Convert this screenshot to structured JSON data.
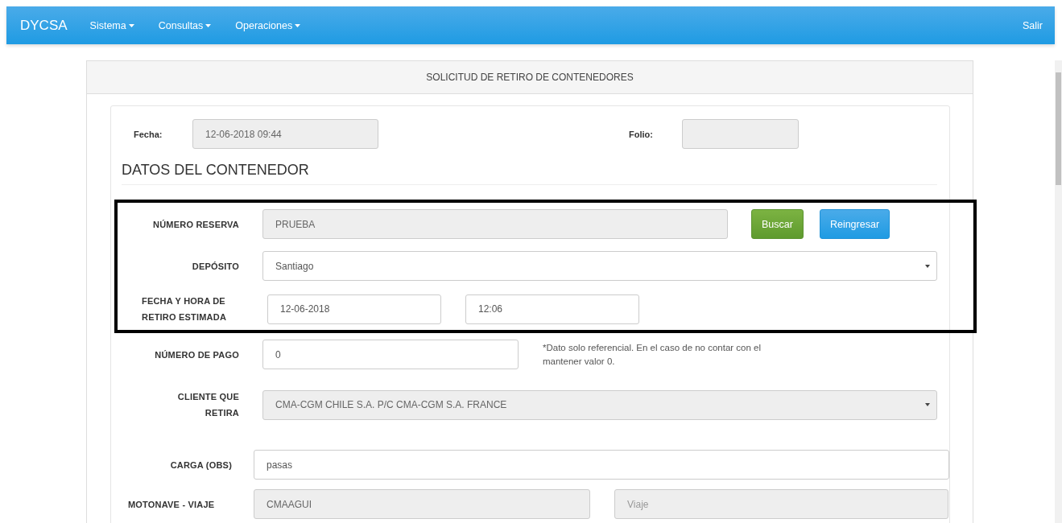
{
  "navbar": {
    "brand": "DYCSA",
    "menus": [
      {
        "label": "Sistema"
      },
      {
        "label": "Consultas"
      },
      {
        "label": "Operaciones"
      }
    ],
    "logout": "Salir"
  },
  "panel": {
    "title": "SOLICITUD DE RETIRO DE CONTENEDORES"
  },
  "header_fields": [
    {
      "label": "Fecha:",
      "value": "12-06-2018 09:44",
      "disabled": true
    },
    {
      "label": "Folio:",
      "disabled": true
    }
  ],
  "section_title": "DATOS DEL CONTENEDOR",
  "highlighted_rows": [
    {
      "kind": "reserva",
      "label": "NÚMERO RESERVA",
      "fields": [
        {
          "value": "PRUEBA",
          "disabled": true
        }
      ],
      "buttons": [
        {
          "label": "Buscar",
          "kind": "success"
        },
        {
          "label": "Reingresar",
          "kind": "primary"
        }
      ]
    },
    {
      "kind": "wide",
      "label": "DEPÓSITO",
      "fields": [
        {
          "value": "Santiago",
          "disabled": false
        }
      ]
    },
    {
      "kind": "datetime",
      "label": "FECHA Y HORA DE RETIRO ESTIMADA",
      "fields": [
        {
          "value": "12-06-2018",
          "disabled": false
        },
        {
          "value": "12:06",
          "disabled": false
        }
      ]
    }
  ],
  "rows": [
    {
      "kind": "note",
      "label": "NÚMERO DE PAGO",
      "fields": [
        {
          "value": "0",
          "disabled": false
        }
      ],
      "note": "*Dato solo referencial. En el caso de no contar con el mantener valor 0."
    },
    {
      "kind": "wide",
      "label": "CLIENTE QUE RETIRA",
      "fields": [
        {
          "value": "CMA-CGM CHILE S.A. P/C CMA-CGM S.A. FRANCE",
          "disabled": true
        }
      ]
    },
    {
      "kind": "full",
      "label": "CARGA (OBS)",
      "fields": [
        {
          "value": "pasas",
          "disabled": false
        }
      ]
    },
    {
      "kind": "pair",
      "label": "MOTONAVE - VIAJE",
      "fields": [
        {
          "value": "CMAAGUI",
          "disabled": true
        },
        {
          "placeholder": "Viaje",
          "disabled": true
        }
      ]
    }
  ]
}
